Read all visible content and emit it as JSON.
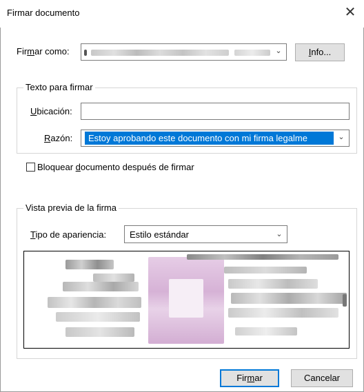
{
  "window": {
    "title": "Firmar documento",
    "close_glyph": "✕"
  },
  "sign_as": {
    "label_pre": "Fir",
    "label_mnemonic": "m",
    "label_post": "ar como:",
    "info_mnemonic": "I",
    "info_post": "nfo..."
  },
  "text_group": {
    "title": "Texto para firmar",
    "location": {
      "label_mnemonic": "U",
      "label_post": "bicación:",
      "value": ""
    },
    "reason": {
      "label_mnemonic": "R",
      "label_post": "azón:",
      "value": "Estoy aprobando este documento con mi firma legalme"
    }
  },
  "lock_checkbox": {
    "label_pre": "Bloquear ",
    "label_mnemonic": "d",
    "label_post": "ocumento después de firmar",
    "checked": false
  },
  "preview_group": {
    "title": "Vista previa de la firma",
    "appearance": {
      "label_mnemonic": "T",
      "label_post": "ipo de apariencia:",
      "value": "Estilo estándar"
    }
  },
  "buttons": {
    "sign_pre": "Fir",
    "sign_mnemonic": "m",
    "sign_post": "ar",
    "cancel": "Cancelar"
  },
  "icons": {
    "dropdown": "chevron-down-icon",
    "close": "close-icon"
  },
  "colors": {
    "selection": "#0078d7",
    "default_button_border": "#0078d7",
    "preview_highlight": "#d9b7da"
  }
}
